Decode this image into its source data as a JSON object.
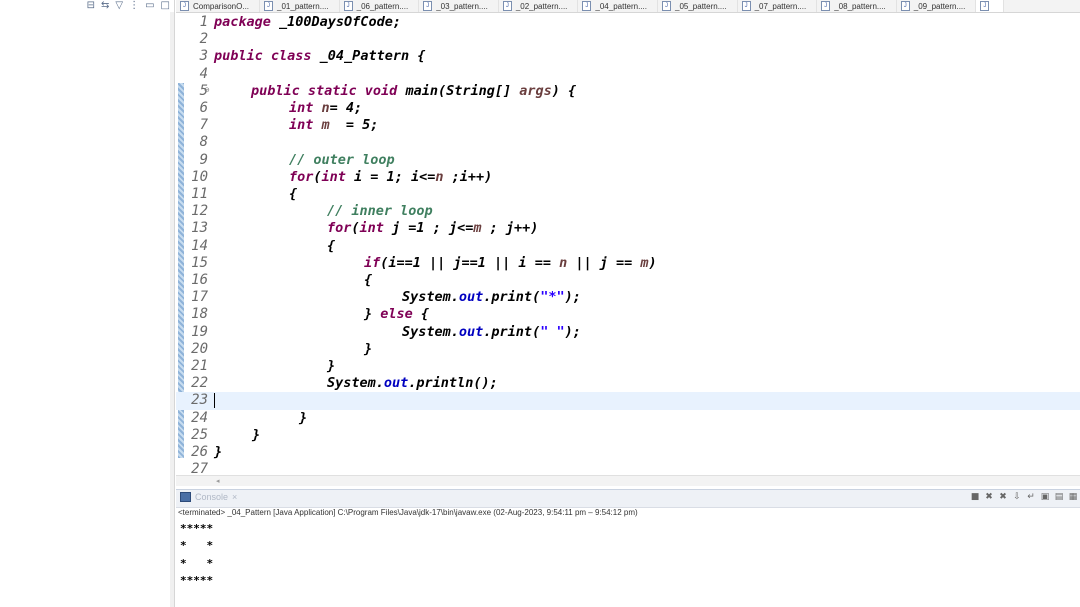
{
  "tabs": [
    "ComparisonO...",
    "_01_pattern....",
    "_06_pattern....",
    "_03_pattern....",
    "_02_pattern....",
    "_04_pattern....",
    "_05_pattern....",
    "_07_pattern....",
    "_08_pattern....",
    "_09_pattern....",
    "J"
  ],
  "code_lines": [
    {
      "n": "1"
    },
    {
      "n": "2"
    },
    {
      "n": "3"
    },
    {
      "n": "4"
    },
    {
      "n": "5"
    },
    {
      "n": "6"
    },
    {
      "n": "7"
    },
    {
      "n": "8"
    },
    {
      "n": "9"
    },
    {
      "n": "10"
    },
    {
      "n": "11"
    },
    {
      "n": "12"
    },
    {
      "n": "13"
    },
    {
      "n": "14"
    },
    {
      "n": "15"
    },
    {
      "n": "16"
    },
    {
      "n": "17"
    },
    {
      "n": "18"
    },
    {
      "n": "19"
    },
    {
      "n": "20"
    },
    {
      "n": "21"
    },
    {
      "n": "22"
    },
    {
      "n": "23"
    },
    {
      "n": "24"
    },
    {
      "n": "25"
    },
    {
      "n": "26"
    },
    {
      "n": "27"
    }
  ],
  "code": {
    "l1_kw": "package",
    "l1_rest": " _100DaysOfCode;",
    "l3_kw": "public class",
    "l3_rest": " _04_Pattern {",
    "l5_kw": "public static void",
    "l5_a": " main(String[] ",
    "l5_var": "args",
    "l5_b": ") {",
    "l6_kw": "int",
    "l6_var": "n",
    "l6_rest": "= 4;",
    "l7_kw": "int",
    "l7_var": "m",
    "l7_rest": "  = 5;",
    "l9_cm": "// outer loop",
    "l10_kw": "for",
    "l10_a": "(",
    "l10_kw2": "int",
    "l10_b": " i = 1; i<=",
    "l10_var": "n",
    "l10_c": " ;i++)",
    "l11": "{",
    "l12_cm": "// inner loop",
    "l13_kw": "for",
    "l13_a": "(",
    "l13_kw2": "int",
    "l13_b": " j =1 ; j<=",
    "l13_var": "m",
    "l13_c": " ; j++)",
    "l14": "{",
    "l15_kw": "if",
    "l15_a": "(i==1 || j==1 || i == ",
    "l15_v1": "n",
    "l15_b": " || j == ",
    "l15_v2": "m",
    "l15_c": ")",
    "l16": "{",
    "l17_a": "System.",
    "l17_fd": "out",
    "l17_b": ".print(",
    "l17_st": "\"*\"",
    "l17_c": ");",
    "l18_a": "} ",
    "l18_kw": "else",
    "l18_b": " {",
    "l19_a": "System.",
    "l19_fd": "out",
    "l19_b": ".print(",
    "l19_st": "\" \"",
    "l19_c": ");",
    "l20": "}",
    "l21": "}",
    "l22_a": "System.",
    "l22_fd": "out",
    "l22_b": ".println();",
    "l24": "}",
    "l25": "}",
    "l26": "}"
  },
  "console": {
    "tab_label": "Console",
    "status": "<terminated> _04_Pattern [Java Application] C:\\Program Files\\Java\\jdk-17\\bin\\javaw.exe  (02-Aug-2023, 9:54:11 pm – 9:54:12 pm)",
    "output": [
      "*****",
      "*   *",
      "*   *",
      "*****"
    ]
  }
}
